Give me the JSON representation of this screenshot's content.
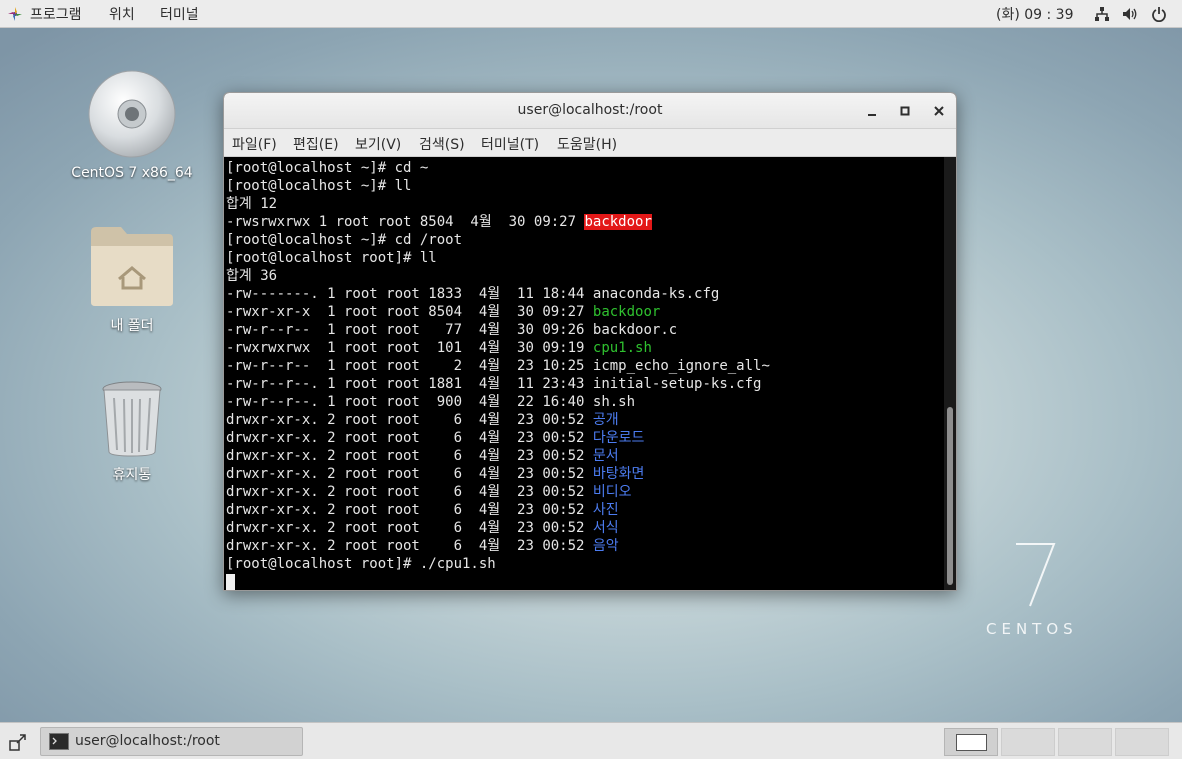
{
  "top_bar": {
    "menus": [
      "프로그램",
      "위치",
      "터미널"
    ],
    "clock": "(화) 09 : 39",
    "tray_icons": [
      "network-icon",
      "volume-icon",
      "power-icon"
    ]
  },
  "desktop": {
    "icons": [
      {
        "label": "CentOS 7 x86_64",
        "icon": "disc-icon"
      },
      {
        "label": "내 폴더",
        "icon": "home-folder-icon"
      },
      {
        "label": "휴지통",
        "icon": "trash-icon"
      }
    ],
    "watermark": {
      "number": "7",
      "word": "CENTOS"
    }
  },
  "terminal": {
    "title": "user@localhost:/root",
    "menus": [
      "파일(F)",
      "편집(E)",
      "보기(V)",
      "검색(S)",
      "터미널(T)",
      "도움말(H)"
    ],
    "lines": [
      [
        {
          "t": "[root@localhost ~]# cd ~",
          "c": "white"
        }
      ],
      [
        {
          "t": "[root@localhost ~]# ll",
          "c": "white"
        }
      ],
      [
        {
          "t": "합계 12",
          "c": "white"
        }
      ],
      [
        {
          "t": "-rwsrwxrwx 1 root root 8504  4월  30 09:27 ",
          "c": "white"
        },
        {
          "t": "backdoor",
          "c": "hl"
        }
      ],
      [
        {
          "t": "[root@localhost ~]# cd /root",
          "c": "white"
        }
      ],
      [
        {
          "t": "[root@localhost root]# ll",
          "c": "white"
        }
      ],
      [
        {
          "t": "합계 36",
          "c": "white"
        }
      ],
      [
        {
          "t": "-rw-------. 1 root root 1833  4월  11 18:44 anaconda-ks.cfg",
          "c": "white"
        }
      ],
      [
        {
          "t": "-rwxr-xr-x  1 root root 8504  4월  30 09:27 ",
          "c": "white"
        },
        {
          "t": "backdoor",
          "c": "green"
        }
      ],
      [
        {
          "t": "-rw-r--r--  1 root root   77  4월  30 09:26 backdoor.c",
          "c": "white"
        }
      ],
      [
        {
          "t": "-rwxrwxrwx  1 root root  101  4월  30 09:19 ",
          "c": "white"
        },
        {
          "t": "cpu1.sh",
          "c": "green"
        }
      ],
      [
        {
          "t": "-rw-r--r--  1 root root    2  4월  23 10:25 icmp_echo_ignore_all~",
          "c": "white"
        }
      ],
      [
        {
          "t": "-rw-r--r--. 1 root root 1881  4월  11 23:43 initial-setup-ks.cfg",
          "c": "white"
        }
      ],
      [
        {
          "t": "-rw-r--r--. 1 root root  900  4월  22 16:40 sh.sh",
          "c": "white"
        }
      ],
      [
        {
          "t": "drwxr-xr-x. 2 root root    6  4월  23 00:52 ",
          "c": "white"
        },
        {
          "t": "공개",
          "c": "blue"
        }
      ],
      [
        {
          "t": "drwxr-xr-x. 2 root root    6  4월  23 00:52 ",
          "c": "white"
        },
        {
          "t": "다운로드",
          "c": "blue"
        }
      ],
      [
        {
          "t": "drwxr-xr-x. 2 root root    6  4월  23 00:52 ",
          "c": "white"
        },
        {
          "t": "문서",
          "c": "blue"
        }
      ],
      [
        {
          "t": "drwxr-xr-x. 2 root root    6  4월  23 00:52 ",
          "c": "white"
        },
        {
          "t": "바탕화면",
          "c": "blue"
        }
      ],
      [
        {
          "t": "drwxr-xr-x. 2 root root    6  4월  23 00:52 ",
          "c": "white"
        },
        {
          "t": "비디오",
          "c": "blue"
        }
      ],
      [
        {
          "t": "drwxr-xr-x. 2 root root    6  4월  23 00:52 ",
          "c": "white"
        },
        {
          "t": "사진",
          "c": "blue"
        }
      ],
      [
        {
          "t": "drwxr-xr-x. 2 root root    6  4월  23 00:52 ",
          "c": "white"
        },
        {
          "t": "서식",
          "c": "blue"
        }
      ],
      [
        {
          "t": "drwxr-xr-x. 2 root root    6  4월  23 00:52 ",
          "c": "white"
        },
        {
          "t": "음악",
          "c": "blue"
        }
      ],
      [
        {
          "t": "[root@localhost root]# ./cpu1.sh",
          "c": "white"
        }
      ]
    ],
    "colors": {
      "white": "#e6e6e6",
      "green": "#2fc12f",
      "blue": "#4c7cf0",
      "highlight": "#e31818"
    }
  },
  "taskbar": {
    "window_item": "user@localhost:/root",
    "workspaces": 4,
    "active_workspace": 1
  }
}
